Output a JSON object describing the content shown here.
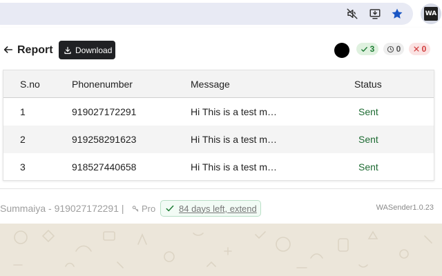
{
  "browser": {
    "toolbar_icons": [
      "mute-icon",
      "install-app-icon",
      "bookmark-star-icon"
    ],
    "extension_logo_text": "WA"
  },
  "header": {
    "title": "Report",
    "download_label": "Download",
    "counts": {
      "sent": "3",
      "pending": "0",
      "failed": "0"
    }
  },
  "table": {
    "columns": [
      "S.no",
      "Phonenumber",
      "Message",
      "Status"
    ],
    "rows": [
      {
        "sno": "1",
        "phone": "919027172291",
        "message": "Hi This is a test m…",
        "status": "Sent"
      },
      {
        "sno": "2",
        "phone": "919258291623",
        "message": "Hi This is a test m…",
        "status": "Sent"
      },
      {
        "sno": "3",
        "phone": "918527440658",
        "message": "Hi This is a test m…",
        "status": "Sent"
      }
    ]
  },
  "footer": {
    "user": "Summaiya - 919027172291 |",
    "plan": "Pro",
    "days_left": "84 days left, extend",
    "version": "WASender1.0.23"
  },
  "colors": {
    "accent_green": "#1e7c34",
    "failed_red": "#d03b3b",
    "dark_button": "#202124"
  }
}
